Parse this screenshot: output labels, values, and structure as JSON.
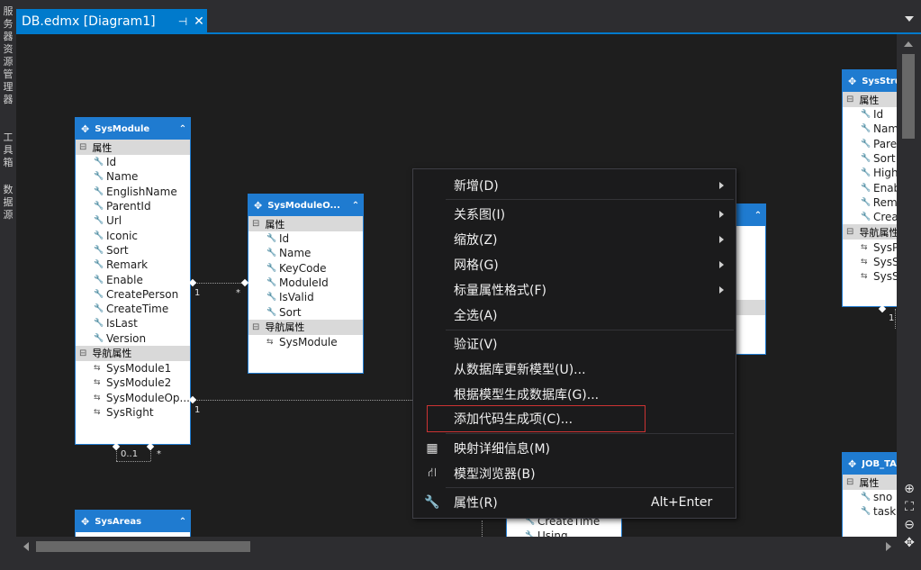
{
  "left_toolbar": {
    "tabs": [
      {
        "label": "服务器资源管理器"
      },
      {
        "label": "工具箱"
      },
      {
        "label": "数据源"
      }
    ]
  },
  "document_tab": {
    "title": "DB.edmx [Diagram1]",
    "pin_glyph": "⊣",
    "close_glyph": "✕"
  },
  "entities": [
    {
      "name": "SysModule",
      "properties_header": "属性",
      "properties": [
        "Id",
        "Name",
        "EnglishName",
        "ParentId",
        "Url",
        "Iconic",
        "Sort",
        "Remark",
        "Enable",
        "CreatePerson",
        "CreateTime",
        "IsLast",
        "Version"
      ],
      "nav_header": "导航属性",
      "nav": [
        "SysModule1",
        "SysModule2",
        "SysModuleOp...",
        "SysRight"
      ]
    },
    {
      "name": "SysModuleO...",
      "properties_header": "属性",
      "properties": [
        "Id",
        "Name",
        "KeyCode",
        "ModuleId",
        "IsValid",
        "Sort"
      ],
      "nav_header": "导航属性",
      "nav": [
        "SysModule"
      ]
    },
    {
      "name": "SysStru",
      "properties_header": "属性",
      "properties": [
        "Id",
        "Nam",
        "Pare",
        "Sort",
        "High",
        "Enab",
        "Rema",
        "Crea"
      ],
      "nav_header": "导航属性",
      "nav": [
        "SysP",
        "SysS",
        "SysS"
      ]
    },
    {
      "name": "SysAreas"
    },
    {
      "name": "JOB_TA",
      "properties_header": "属性",
      "properties": [
        "sno",
        "task"
      ]
    },
    {
      "name": "",
      "properties": [
        "CreateTime",
        "Using"
      ]
    }
  ],
  "multiplicities": {
    "m1": "1",
    "m2": "*",
    "m3": "1",
    "m4": "0..1",
    "m5": "*",
    "m6": "1"
  },
  "context_menu": {
    "items": [
      {
        "label": "新增(D)"
      },
      {
        "label": "关系图(I)"
      },
      {
        "label": "缩放(Z)"
      },
      {
        "label": "网格(G)"
      },
      {
        "label": "标量属性格式(F)"
      },
      {
        "label": "全选(A)"
      },
      {
        "label": "验证(V)"
      },
      {
        "label": "从数据库更新模型(U)..."
      },
      {
        "label": "根据模型生成数据库(G)..."
      },
      {
        "label": "添加代码生成项(C)..."
      },
      {
        "label": "映射详细信息(M)"
      },
      {
        "label": "模型浏览器(B)"
      },
      {
        "label": "属性(R)",
        "shortcut": "Alt+Enter"
      }
    ]
  },
  "colors": {
    "accent": "#007acc",
    "entity_header": "#1f7bd0",
    "highlight_border": "#cc3333"
  }
}
